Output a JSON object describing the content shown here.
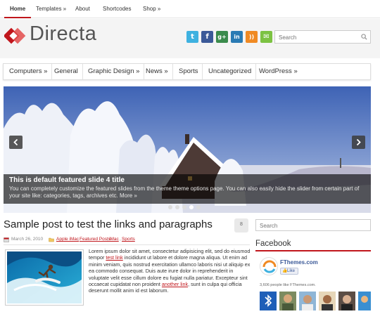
{
  "topnav": {
    "items": [
      "Home",
      "Templates »",
      "About",
      "Shortcodes",
      "Shop »"
    ]
  },
  "brand": {
    "name": "Directa",
    "accent": "#c0161c"
  },
  "social": [
    {
      "name": "twitter-icon",
      "glyph": "t",
      "color": "#3eb1e0"
    },
    {
      "name": "facebook-icon",
      "glyph": "f",
      "color": "#3b5998"
    },
    {
      "name": "google-plus-icon",
      "glyph": "g+",
      "color": "#3b8b4c"
    },
    {
      "name": "linkedin-icon",
      "glyph": "in",
      "color": "#2a7bb4"
    },
    {
      "name": "rss-icon",
      "glyph": "))",
      "color": "#f08a24"
    },
    {
      "name": "email-icon",
      "glyph": "✉",
      "color": "#7cc242"
    }
  ],
  "search": {
    "placeholder": "Search"
  },
  "categories": [
    "Computers »",
    "General",
    "Graphic Design »",
    "News »",
    "Sports",
    "Uncategorized",
    "WordPress »"
  ],
  "slider": {
    "title": "This is default featured slide 4 title",
    "text": "You can completely customize the featured slides from the theme theme options page. You can also easily hide the slider from certain part of your site like: categories, tags, archives etc. More »"
  },
  "post": {
    "title": "Sample post to test the links and paragraphs",
    "comments": "8",
    "date": "March 26, 2010",
    "categories": [
      "Apple iMac",
      "Featured Posts",
      "iMac",
      "Sports"
    ],
    "body_1": "Lorem ipsum dolor sit amet, consectetur adipisicing elit, sed do eiusmod tempor ",
    "link_1": "test link",
    "body_2": " incididunt ut labore et dolore magna aliqua. Ut enim ad minim veniam, quis nostrud exercitation ullamco laboris nisi ut aliquip ex ea commodo consequat. Duis aute irure dolor in reprehenderit in voluptate velit esse cillum dolore eu fugiat nulla pariatur. Excepteur sint occaecat cupidatat non proident ",
    "link_2": "another link",
    "body_3": ", sunt in culpa qui officia deserunt mollit anim id est laborum."
  },
  "sidebar": {
    "search_placeholder": "Search",
    "facebook_title": "Facebook",
    "fb_page": "FThemes.com",
    "fb_like": "Like",
    "fb_count": "3,606 people like FThemes.com."
  }
}
